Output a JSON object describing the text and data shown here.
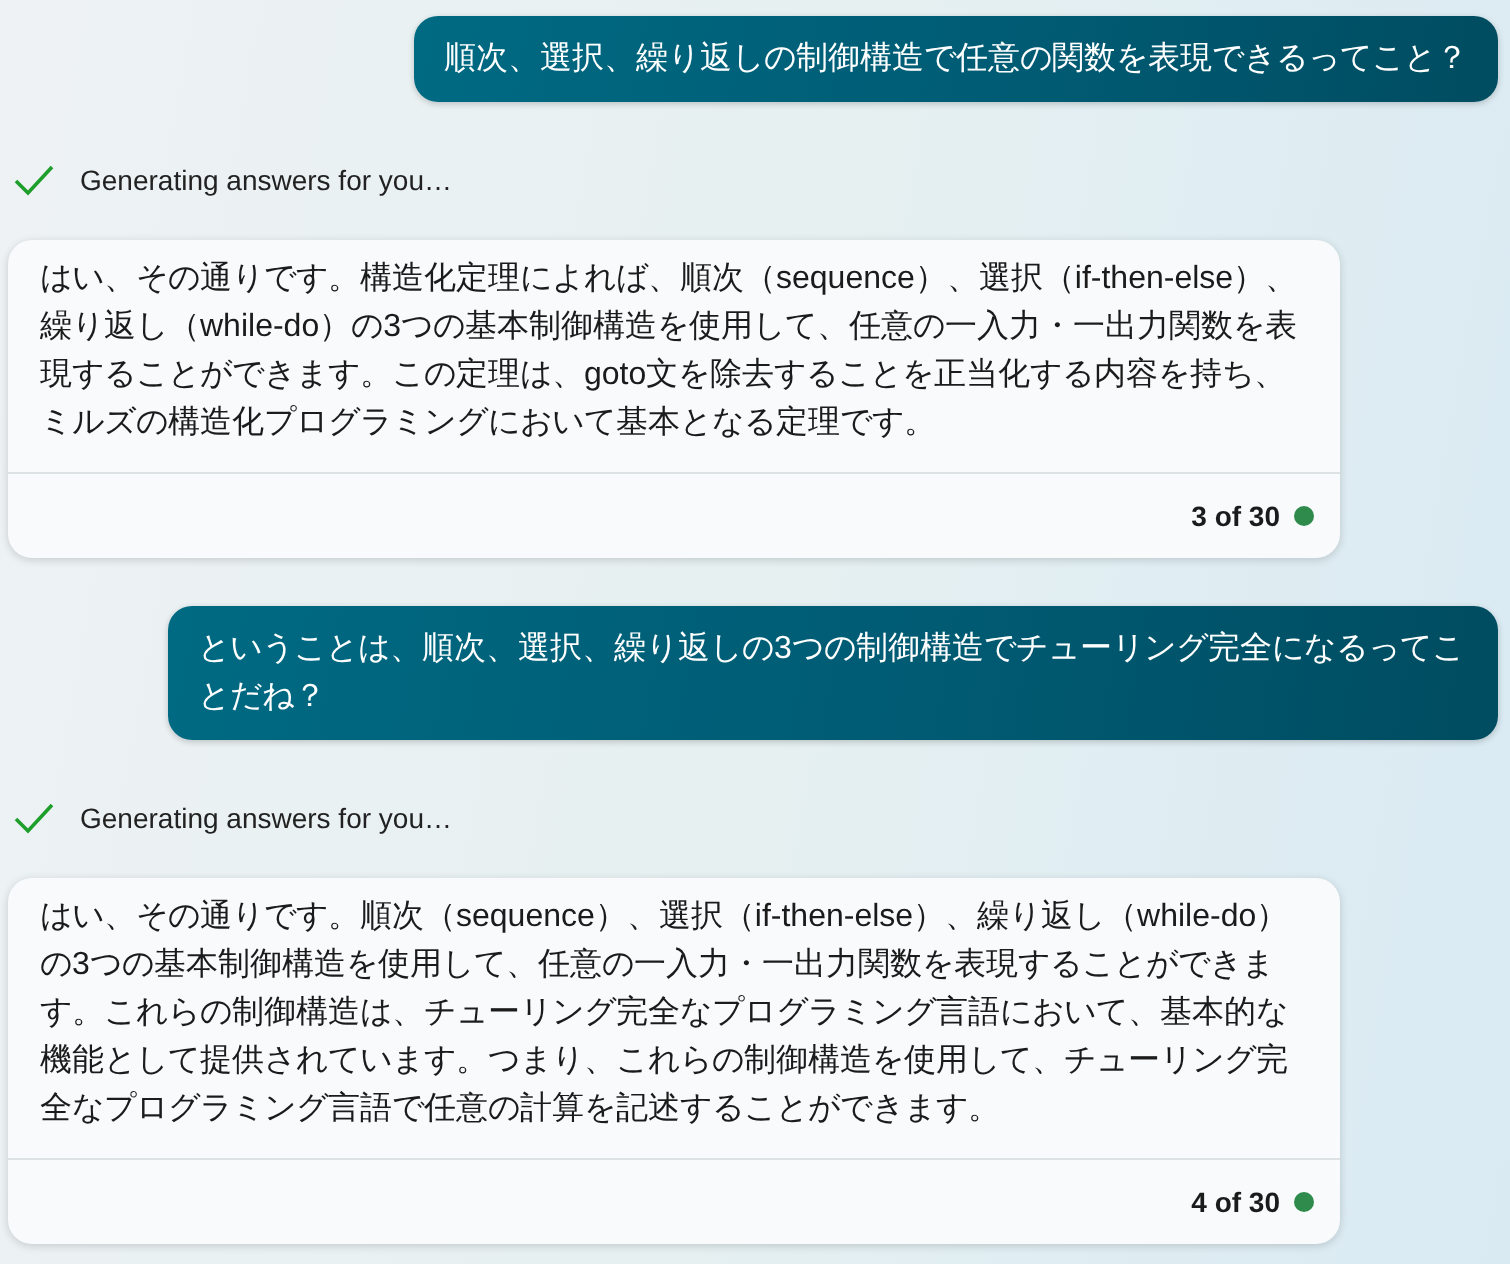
{
  "messages": [
    {
      "kind": "user",
      "text": "順次、選択、繰り返しの制御構造で任意の関数を表現できるってこと？"
    },
    {
      "kind": "status",
      "text": "Generating answers for you…",
      "done": true
    },
    {
      "kind": "answer",
      "text": "はい、その通りです。構造化定理によれば、順次（sequence）、選択（if-then-else）、繰り返し（while-do）の3つの基本制御構造を使用して、任意の一入力・一出力関数を表現することができます。この定理は、goto文を除去することを正当化する内容を持ち、ミルズの構造化プログラミングにおいて基本となる定理です。",
      "count": "3 of 30"
    },
    {
      "kind": "user",
      "text": "ということは、順次、選択、繰り返しの3つの制御構造でチューリング完全になるってことだね？"
    },
    {
      "kind": "status",
      "text": "Generating answers for you…",
      "done": true
    },
    {
      "kind": "answer",
      "text": "はい、その通りです。順次（sequence）、選択（if-then-else）、繰り返し（while-do）の3つの基本制御構造を使用して、任意の一入力・一出力関数を表現することができます。これらの制御構造は、チューリング完全なプログラミング言語において、基本的な機能として提供されています。つまり、これらの制御構造を使用して、チューリング完全なプログラミング言語で任意の計算を記述することができます。",
      "count": "4 of 30"
    }
  ]
}
